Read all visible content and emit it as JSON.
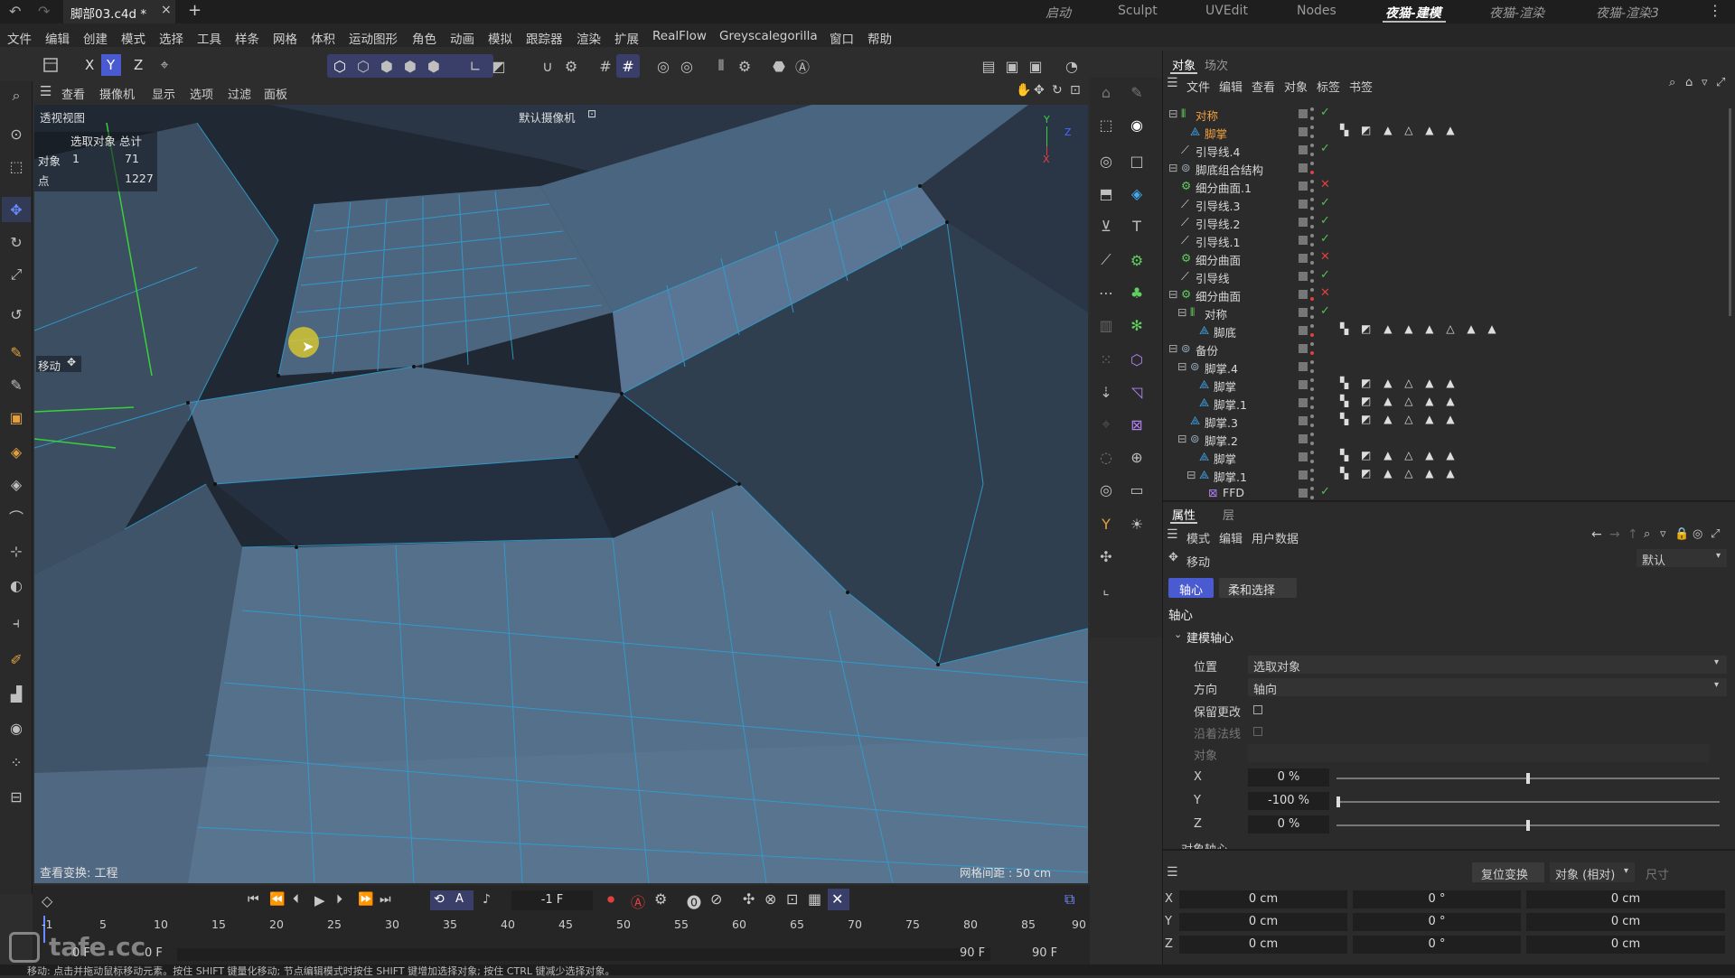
{
  "title_bar": {
    "file_tab": "脚部03.c4d *",
    "close": "×",
    "add": "+",
    "layouts": [
      "启动",
      "Sculpt",
      "UVEdit",
      "Nodes",
      "夜猫-建模",
      "夜猫-渲染",
      "夜猫-渲染3"
    ],
    "active_layout": "夜猫-建模"
  },
  "menus": [
    "文件",
    "编辑",
    "创建",
    "模式",
    "选择",
    "工具",
    "样条",
    "网格",
    "体积",
    "运动图形",
    "角色",
    "动画",
    "模拟",
    "跟踪器",
    "渲染",
    "扩展",
    "RealFlow",
    "Greyscalegorilla",
    "窗口",
    "帮助"
  ],
  "toolbar": {
    "axis_x": "X",
    "axis_y": "Y",
    "axis_z": "Z"
  },
  "viewport_menu": [
    "查看",
    "摄像机",
    "显示",
    "选项",
    "过滤",
    "面板"
  ],
  "viewport": {
    "name": "透视视图",
    "camera": "默认摄像机",
    "stats_header": "选取对象 总计",
    "stats": [
      {
        "label": "对象",
        "sel": "1",
        "total": "71"
      },
      {
        "label": "点",
        "sel": "",
        "total": "1227"
      }
    ],
    "tool_label": "移动",
    "view_transform": "查看变换: 工程",
    "grid_spacing": "网格间距 : 50 cm",
    "colors": {
      "bg": "#1f2833",
      "face_light": "#4f6a84",
      "face_mid": "#3b5166",
      "face_dark": "#2a3a4a",
      "edge": "#2f9fd0"
    }
  },
  "object_manager": {
    "tabs": [
      "对象",
      "场次"
    ],
    "menu": [
      "文件",
      "编辑",
      "查看",
      "对象",
      "标签",
      "书签"
    ],
    "rows": [
      {
        "name": "对称",
        "level": 0,
        "status": "✓",
        "highlight": true
      },
      {
        "name": "脚掌",
        "level": 1,
        "status": "",
        "tags": "▚ ◩ ▲ △ ▲ ▲",
        "highlight": true
      },
      {
        "name": "引导线.4",
        "level": 0,
        "status": "✓"
      },
      {
        "name": "脚底组合结构",
        "level": 0,
        "status": ""
      },
      {
        "name": "细分曲面.1",
        "level": 0,
        "status": "✕"
      },
      {
        "name": "引导线.3",
        "level": 0,
        "status": "✓"
      },
      {
        "name": "引导线.2",
        "level": 0,
        "status": "✓"
      },
      {
        "name": "引导线.1",
        "level": 0,
        "status": "✓"
      },
      {
        "name": "细分曲面",
        "level": 0,
        "status": "✕"
      },
      {
        "name": "引导线",
        "level": 0,
        "status": "✓"
      },
      {
        "name": "细分曲面",
        "level": 0,
        "status": "✕"
      },
      {
        "name": "对称",
        "level": 1,
        "status": "✓"
      },
      {
        "name": "脚底",
        "level": 2,
        "status": "",
        "tags": "▚ ◩ ▲ ▲ ▲ △ ▲ ▲"
      },
      {
        "name": "备份",
        "level": 0,
        "status": ""
      },
      {
        "name": "脚掌.4",
        "level": 1,
        "status": ""
      },
      {
        "name": "脚掌",
        "level": 2,
        "status": "",
        "tags": "▚ ◩ ▲ △ ▲ ▲"
      },
      {
        "name": "脚掌.1",
        "level": 2,
        "status": "",
        "tags": "▚ ◩ ▲ △ ▲ ▲"
      },
      {
        "name": "脚掌.3",
        "level": 1,
        "status": "",
        "tags": "▚ ◩ ▲ △ ▲ ▲"
      },
      {
        "name": "脚掌.2",
        "level": 1,
        "status": ""
      },
      {
        "name": "脚掌",
        "level": 2,
        "status": "",
        "tags": "▚ ◩ ▲ △ ▲ ▲"
      },
      {
        "name": "脚掌.1",
        "level": 2,
        "status": "",
        "tags": "▚ ◩ ▲ △ ▲ ▲"
      },
      {
        "name": "FFD",
        "level": 3,
        "status": "✓"
      }
    ]
  },
  "attributes": {
    "tabs": [
      "属性",
      "层"
    ],
    "menu": [
      "模式",
      "编辑",
      "用户数据"
    ],
    "tool": "移动",
    "preset": "默认",
    "subtabs": [
      "轴心",
      "柔和选择"
    ],
    "section": "轴心",
    "group": "建模轴心",
    "position_label": "位置",
    "position_value": "选取对象",
    "direction_label": "方向",
    "direction_value": "轴向",
    "keep_changes": "保留更改",
    "along_normal": "沿着法线",
    "object_label": "对象",
    "axes": [
      {
        "label": "X",
        "value": "0 %",
        "fraction": 0.5
      },
      {
        "label": "Y",
        "value": "-100 %",
        "fraction": 0.0
      },
      {
        "label": "Z",
        "value": "0 %",
        "fraction": 0.5
      }
    ],
    "partial_label": "对象轴心"
  },
  "coordinates": {
    "reset": "复位变换",
    "mode": "对象 (相对)",
    "size": "尺寸",
    "rows": [
      {
        "axis": "X",
        "pos": "0 cm",
        "rot": "0 °",
        "size": "0 cm"
      },
      {
        "axis": "Y",
        "pos": "0 cm",
        "rot": "0 °",
        "size": "0 cm"
      },
      {
        "axis": "Z",
        "pos": "0 cm",
        "rot": "0 °",
        "size": "0 cm"
      }
    ]
  },
  "timeline": {
    "current_frame": "-1 F",
    "ticks": [
      "-1",
      "5",
      "10",
      "15",
      "20",
      "25",
      "30",
      "35",
      "40",
      "45",
      "50",
      "55",
      "60",
      "65",
      "70",
      "75",
      "80",
      "85",
      "90"
    ],
    "start": "0 F",
    "start2": "0 F",
    "end": "90 F",
    "end2": "90 F"
  },
  "status": "移动: 点击并拖动鼠标移动元素。按住 SHIFT 键量化移动; 节点编辑模式时按住 SHIFT 键增加选择对象; 按住 CTRL 键减少选择对象。",
  "watermark": "tafe.cc"
}
